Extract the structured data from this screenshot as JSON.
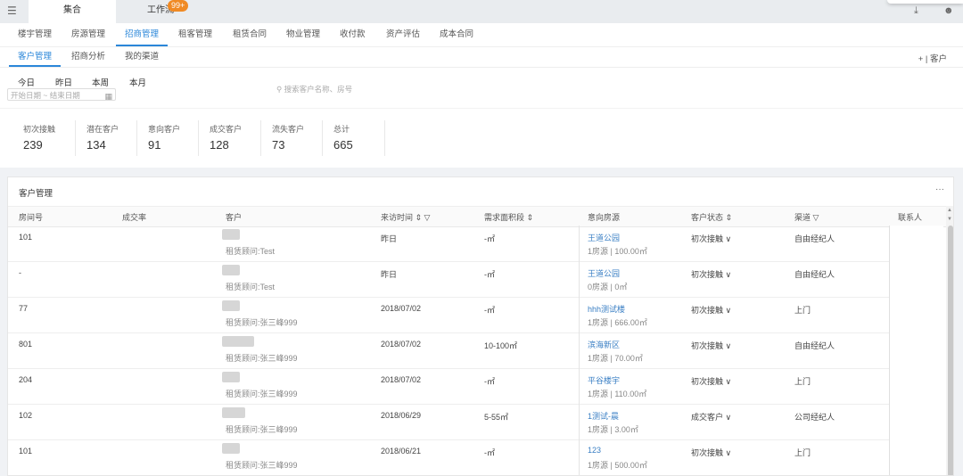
{
  "top_tabs": [
    {
      "label": "集合"
    },
    {
      "label": "工作流"
    }
  ],
  "badge": "99+",
  "main_nav": [
    "楼宇管理",
    "房源管理",
    "招商管理",
    "租客管理",
    "租赁合同",
    "物业管理",
    "收付款",
    "资产评估",
    "成本合同"
  ],
  "sub_nav": [
    "客户管理",
    "招商分析",
    "我的渠道"
  ],
  "add_customer": "+ | 客户",
  "quick_dates": [
    "今日",
    "昨日",
    "本周",
    "本月"
  ],
  "date_range": {
    "start": "开始日期",
    "sep": "~",
    "end": "结束日期"
  },
  "search_placeholder": "搜索客户名称、房号",
  "stats": [
    {
      "label": "初次接触",
      "value": "239"
    },
    {
      "label": "潜在客户",
      "value": "134"
    },
    {
      "label": "意向客户",
      "value": "91"
    },
    {
      "label": "成交客户",
      "value": "128"
    },
    {
      "label": "流失客户",
      "value": "73"
    },
    {
      "label": "总计",
      "value": "665"
    }
  ],
  "table": {
    "title": "客户管理",
    "more": "···",
    "headers": [
      "房间号",
      "成交率",
      "客户",
      "来访时间 ⇕ ▽",
      "需求面积段 ⇕",
      "意向房源",
      "客户状态 ⇕",
      "渠道 ▽",
      "联系人"
    ],
    "rows": [
      {
        "room": "101",
        "advisor": "租赁顾问:Test",
        "time": "昨日",
        "area": "-㎡",
        "prop": "王道公园",
        "prop_sub": "1房源 | 100.00㎡",
        "status": "初次接触 ∨",
        "channel": "自由经纪人"
      },
      {
        "room": "-",
        "advisor": "租赁顾问:Test",
        "time": "昨日",
        "area": "-㎡",
        "prop": "王道公园",
        "prop_sub": "0房源 | 0㎡",
        "status": "初次接触 ∨",
        "channel": "自由经纪人"
      },
      {
        "room": "77",
        "advisor": "租赁顾问:张三峰999",
        "time": "2018/07/02",
        "area": "-㎡",
        "prop": "hhh测试楼",
        "prop_sub": "1房源 | 666.00㎡",
        "status": "初次接触 ∨",
        "channel": "上门"
      },
      {
        "room": "801",
        "advisor": "租赁顾问:张三峰999",
        "time": "2018/07/02",
        "area": "10-100㎡",
        "prop": "滨海新区",
        "prop_sub": "1房源 | 70.00㎡",
        "status": "初次接触 ∨",
        "channel": "自由经纪人"
      },
      {
        "room": "204",
        "advisor": "租赁顾问:张三峰999",
        "time": "2018/07/02",
        "area": "-㎡",
        "prop": "平谷楼宇",
        "prop_sub": "1房源 | 110.00㎡",
        "status": "初次接触 ∨",
        "channel": "上门"
      },
      {
        "room": "102",
        "advisor": "租赁顾问:张三峰999",
        "time": "2018/06/29",
        "area": "5-55㎡",
        "prop": "1测试-晨",
        "prop_sub": "1房源 | 3.00㎡",
        "status": "成交客户 ∨",
        "channel": "公司经纪人"
      },
      {
        "room": "101",
        "advisor": "租赁顾问:张三峰999",
        "time": "2018/06/21",
        "area": "-㎡",
        "prop": "123",
        "prop_sub": "1房源 | 500.00㎡",
        "status": "初次接触 ∨",
        "channel": "上门"
      }
    ]
  },
  "icons": {
    "menu": "menu-icon",
    "download": "download-icon",
    "user": "user-icon",
    "search": "search-icon",
    "calendar": "calendar-icon"
  },
  "colors": {
    "accent": "#2b87d9",
    "badge": "#f08a24",
    "link": "#3a7fc4"
  }
}
